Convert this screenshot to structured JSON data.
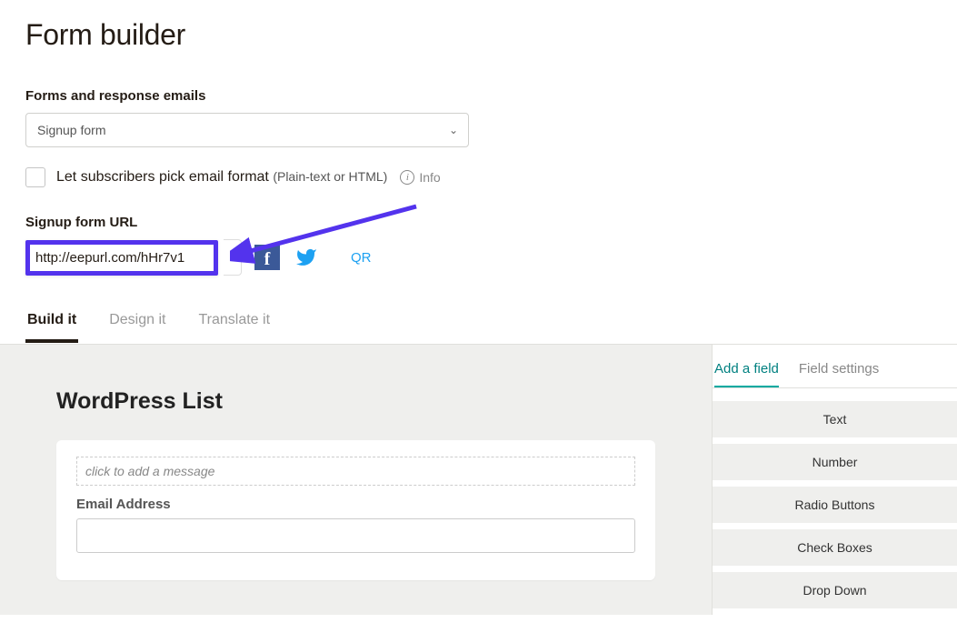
{
  "page_title": "Form builder",
  "forms_label": "Forms and response emails",
  "forms_selected": "Signup form",
  "checkbox": {
    "label": "Let subscribers pick email format",
    "hint": "(Plain-text or HTML)",
    "info": "Info"
  },
  "signup_url_label": "Signup form URL",
  "signup_url": "http://eepurl.com/hHr7v1",
  "qr_label": "QR",
  "main_tabs": [
    "Build it",
    "Design it",
    "Translate it"
  ],
  "form_preview": {
    "title": "WordPress List",
    "msg_placeholder": "click to add a message",
    "email_label": "Email Address"
  },
  "side_tabs": [
    "Add a field",
    "Field settings"
  ],
  "field_options": [
    "Text",
    "Number",
    "Radio Buttons",
    "Check Boxes",
    "Drop Down"
  ]
}
